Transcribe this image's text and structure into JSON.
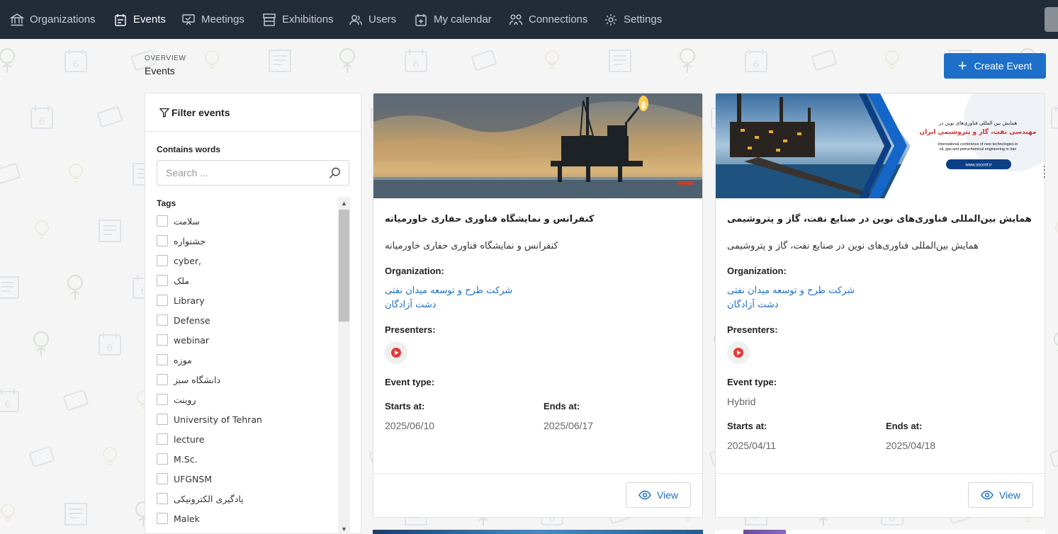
{
  "nav": {
    "items": [
      {
        "label": "Organizations",
        "icon": "bank-icon"
      },
      {
        "label": "Events",
        "icon": "calendar-list-icon",
        "active": true
      },
      {
        "label": "Meetings",
        "icon": "presentation-icon"
      },
      {
        "label": "Exhibitions",
        "icon": "storefront-icon"
      },
      {
        "label": "Users",
        "icon": "users-icon"
      },
      {
        "label": "My calendar",
        "icon": "calendar-plus-icon"
      },
      {
        "label": "Connections",
        "icon": "connections-icon"
      },
      {
        "label": "Settings",
        "icon": "gear-icon"
      }
    ]
  },
  "header": {
    "overview": "OVERVIEW",
    "title": "Events",
    "create_label": "Create Event"
  },
  "filter": {
    "title": "Filter events",
    "contains_label": "Contains words",
    "search_placeholder": "Search ...",
    "tags_label": "Tags",
    "tags": [
      "سلامت",
      "جشنواره",
      "cyber,",
      "ملک",
      "Library",
      "Defense",
      "webinar",
      "موزه",
      "دانشگاه سبز",
      "روینت",
      "University of Tehran",
      "lecture",
      "M.Sc.",
      "UFGNSM",
      "یادگیری الکترونیکی",
      "Malek"
    ]
  },
  "events": [
    {
      "title": "کنفرانس و نمایشگاه فناوری حفاری خاورمیانه",
      "description": "کنفرانس و نمایشگاه فناوری حفاری خاورمیانه",
      "organization_label": "Organization:",
      "organization_line1": "شرکت طرح و توسعه میدان نفتی",
      "organization_line2": "دشت آزادگان",
      "presenters_label": "Presenters:",
      "event_type_label": "Event type:",
      "event_type": "",
      "starts_label": "Starts at:",
      "starts": "2025/06/10",
      "ends_label": "Ends at:",
      "ends": "2025/06/17",
      "view_label": "View"
    },
    {
      "title": "همایش بین‌المللی فناوری‌های نوین در صنایع نفت، گاز و پتروشیمی",
      "description": "همایش بین‌المللی فناوری‌های نوین در صنایع نفت، گاز و پتروشیمی",
      "organization_label": "Organization:",
      "organization_line1": "شرکت طرح و توسعه میدان نفتی",
      "organization_line2": "دشت آزادگان",
      "presenters_label": "Presenters:",
      "event_type_label": "Event type:",
      "event_type": "Hybrid",
      "starts_label": "Starts at:",
      "starts": "2025/04/11",
      "ends_label": "Ends at:",
      "ends": "2025/04/18",
      "view_label": "View",
      "banner": {
        "line1": "همایش بین المللی فناوری‌های نوین در",
        "line2": "مهندسی نفت، گاز و پتروشیمی ایران",
        "en1": "International conference of new technologies in",
        "en2": "oil, gas and petrochemical engineering in Iran",
        "url": "www.osconf.ir"
      }
    }
  ],
  "colors": {
    "nav_bg": "#222b38",
    "accent": "#1d6fc9",
    "page_bg": "#f5f5f5"
  }
}
